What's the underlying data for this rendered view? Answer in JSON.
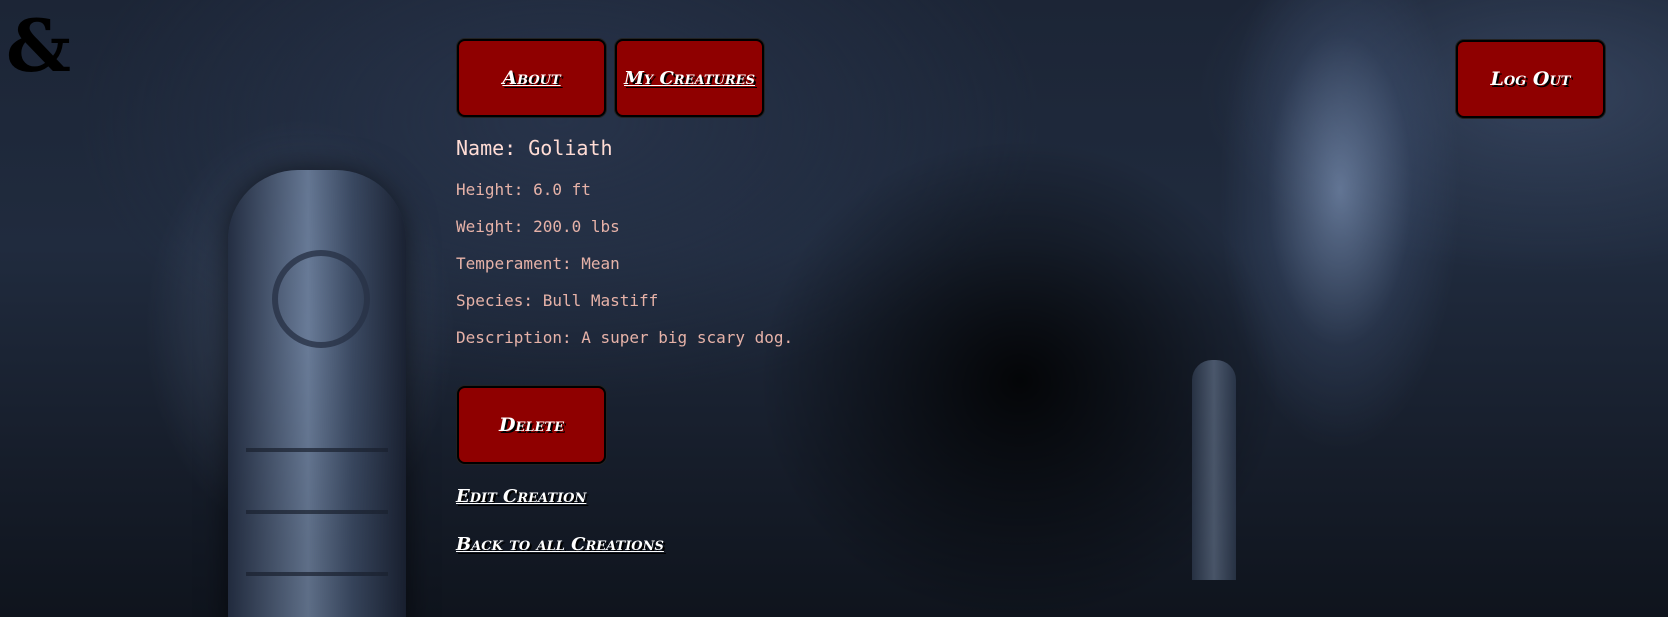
{
  "app": {
    "logo_text": "&"
  },
  "nav": {
    "about_label": "About",
    "my_creatures_label": "My Creatures",
    "logout_label": "Log Out"
  },
  "creature": {
    "name_line": "Name: Goliath",
    "height_line": "Height: 6.0 ft",
    "weight_line": "Weight: 200.0 lbs",
    "temperament_line": "Temperament: Mean",
    "species_line": "Species: Bull Mastiff",
    "description_line": "Description: A super big scary dog."
  },
  "actions": {
    "delete_label": "Delete",
    "edit_label": "Edit Creation",
    "back_label": "Back to all Creations"
  },
  "colors": {
    "button_bg": "#8f0000",
    "text_accent": "#f3c2b8"
  },
  "icons": {
    "logo": "ampersand-logo-icon"
  }
}
